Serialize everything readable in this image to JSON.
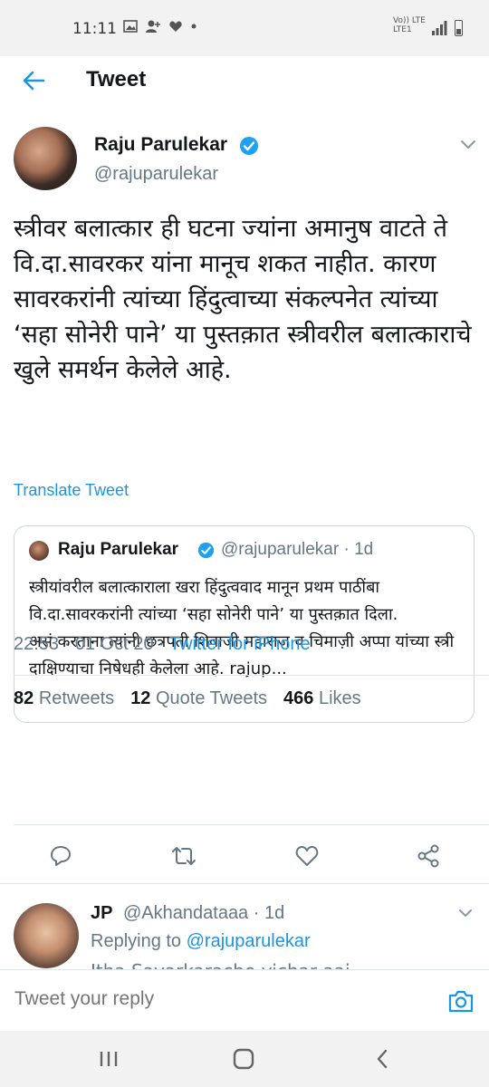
{
  "status_bar": {
    "time": "11:11",
    "icons": [
      "image-icon",
      "person-add-icon",
      "heart-icon",
      "dot-icon"
    ],
    "network_label_top": "Vo)) LTE",
    "network_label_bottom": "LTE1"
  },
  "header": {
    "back_icon": "arrow-left-icon",
    "title": "Tweet"
  },
  "tweet": {
    "author_name": "Raju Parulekar",
    "author_handle": "@rajuparulekar",
    "verified": true,
    "text": "स्त्रीवर बलात्कार ही घटना ज्यांना अमानुष वाटते ते वि.दा.सावरकर यांना मानूच शकत नाहीत. कारण सावरकरांनी त्यांच्या हिंदुत्वाच्या संकल्पनेत त्यांच्या ‘सहा सोनेरी पाने’ या पुस्तक़ात  स्त्रीवरील बलात्काराचे खुले समर्थन केलेले आहे.",
    "translate_label": "Translate Tweet",
    "time": "22:53",
    "date": "01 Oct 20",
    "source": "Twitter for iPhone"
  },
  "quote": {
    "author_name": "Raju Parulekar",
    "author_handle": "@rajuparulekar",
    "age": "1d",
    "text_line_1": "स्त्रीयांवरील बलात्काराला खरा हिंदुत्ववाद मानून प्रथम पाठींबा वि.दा.सावरकरांनी त्यांच्या ‘सहा सोनेरी पाने’ या पुस्तक़ात दिला.",
    "text_line_2": "असं करताना त्यांनी छत्रपती शिवाजी महाराज व चिमाज़ी अप्पा यांच्या स्त्री दाक्षिण्याचा निषेधही केलेला आहे. rajup..."
  },
  "stats": {
    "retweets_count": "82",
    "retweets_label": "Retweets",
    "quote_tweets_count": "12",
    "quote_tweets_label": "Quote Tweets",
    "likes_count": "466",
    "likes_label": "Likes"
  },
  "actions": [
    "reply-icon",
    "retweet-icon",
    "like-icon",
    "share-icon"
  ],
  "reply": {
    "author_name": "JP",
    "author_handle": "@Akhandataaa",
    "age": "1d",
    "replying_to_label": "Replying to",
    "replying_to_handle": "@rajuparulekar",
    "partial_text": "Itha Savarkarache vichar aaj ..."
  },
  "compose": {
    "placeholder": "Tweet your reply"
  },
  "colors": {
    "accent": "#1b95e0",
    "text": "#14171a",
    "muted": "#657786",
    "border": "#e1e8ed"
  }
}
